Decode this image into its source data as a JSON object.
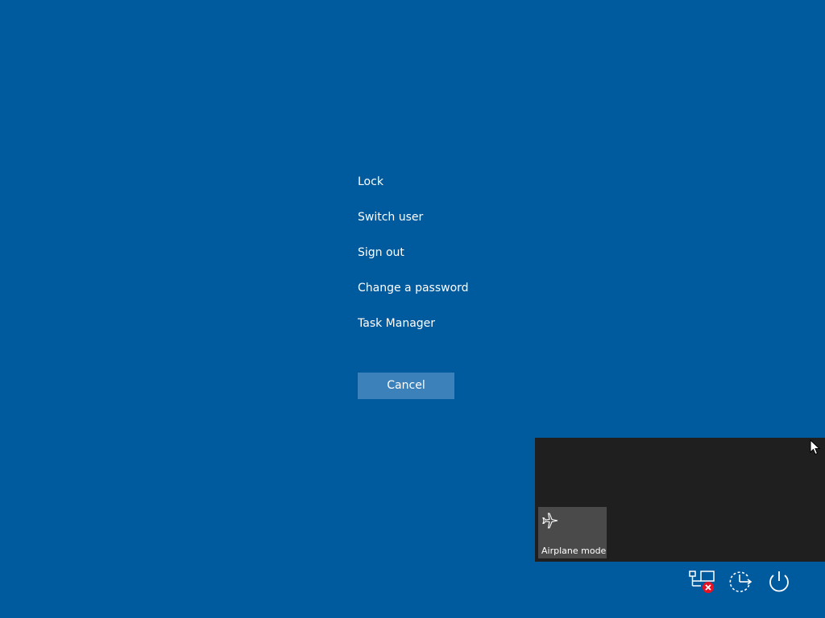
{
  "menu": {
    "items": [
      {
        "label": "Lock"
      },
      {
        "label": "Switch user"
      },
      {
        "label": "Sign out"
      },
      {
        "label": "Change a password"
      },
      {
        "label": "Task Manager"
      }
    ]
  },
  "cancel": {
    "label": "Cancel"
  },
  "quick_actions": {
    "tiles": [
      {
        "label": "Airplane mode",
        "icon": "airplane-icon"
      }
    ]
  },
  "tray": {
    "icons": [
      "network-disconnected-icon",
      "ease-of-access-icon",
      "power-icon"
    ]
  },
  "colors": {
    "background": "#005a9e",
    "cancel_button": "#3d81ba",
    "flyout": "#1f1f1f",
    "tile": "#4a4a4a",
    "error_badge": "#e81123"
  }
}
